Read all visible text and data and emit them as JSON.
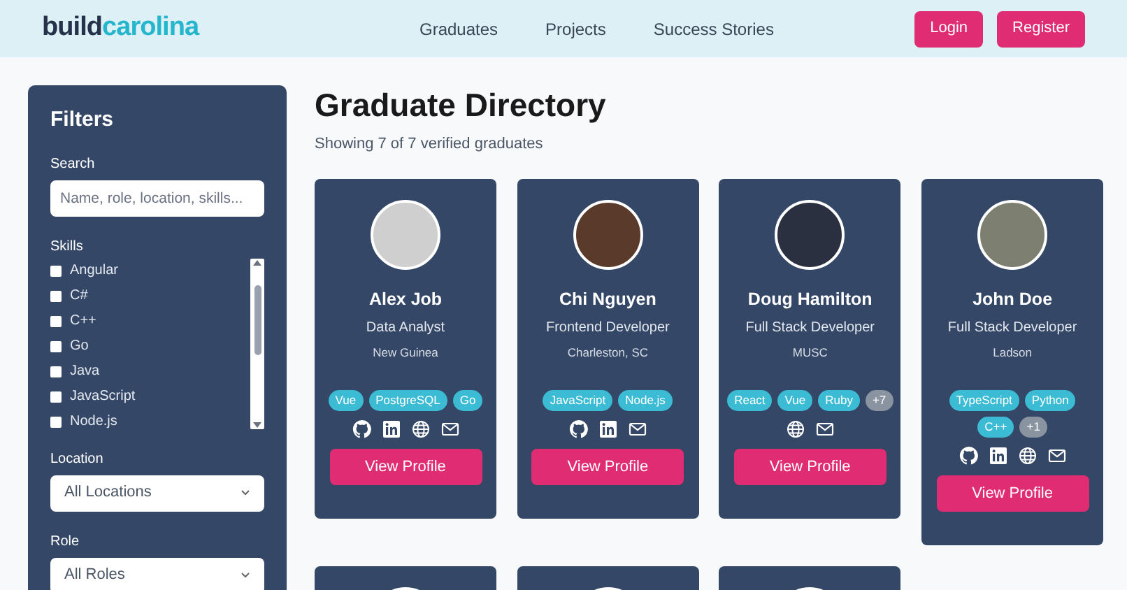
{
  "header": {
    "logo": {
      "part_1": "build",
      "part_2": "carolina"
    },
    "nav": [
      "Graduates",
      "Projects",
      "Success Stories"
    ],
    "buttons": [
      "Login",
      "Register"
    ]
  },
  "filters": {
    "title": "Filters",
    "search": {
      "label": "Search",
      "placeholder": "Name, role, location, skills..."
    },
    "skills": {
      "label": "Skills",
      "options": [
        {
          "label": "Angular",
          "checked": false
        },
        {
          "label": "C#",
          "checked": false
        },
        {
          "label": "C++",
          "checked": false
        },
        {
          "label": "Go",
          "checked": false
        },
        {
          "label": "Java",
          "checked": false
        },
        {
          "label": "JavaScript",
          "checked": false
        },
        {
          "label": "Node.js",
          "checked": false
        }
      ]
    },
    "location": {
      "label": "Location",
      "value": "All Locations"
    },
    "role": {
      "label": "Role",
      "value": "All Roles"
    }
  },
  "directory": {
    "title": "Graduate Directory",
    "summary": "Showing 7 of 7 verified graduates"
  },
  "graduates": [
    {
      "name": "Alex Job",
      "role": "Data Analyst",
      "location": "New Guinea",
      "skills": [
        {
          "label": "Vue",
          "kind": "skill"
        },
        {
          "label": "PostgreSQL",
          "kind": "skill"
        },
        {
          "label": "Go",
          "kind": "skill"
        }
      ],
      "links": [
        {
          "kind": "github"
        },
        {
          "kind": "linkedin"
        },
        {
          "kind": "web"
        },
        {
          "kind": "email"
        }
      ],
      "button": "View Profile"
    },
    {
      "name": "Chi Nguyen",
      "role": "Frontend Developer",
      "location": "Charleston, SC",
      "skills": [
        {
          "label": "JavaScript",
          "kind": "skill"
        },
        {
          "label": "Node.js",
          "kind": "skill"
        }
      ],
      "links": [
        {
          "kind": "github"
        },
        {
          "kind": "linkedin"
        },
        {
          "kind": "email"
        }
      ],
      "button": "View Profile"
    },
    {
      "name": "Doug Hamilton",
      "role": "Full Stack Developer",
      "location": "MUSC",
      "skills": [
        {
          "label": "React",
          "kind": "skill"
        },
        {
          "label": "Vue",
          "kind": "skill"
        },
        {
          "label": "Ruby",
          "kind": "skill"
        },
        {
          "label": "+7",
          "kind": "more"
        }
      ],
      "links": [
        {
          "kind": "web"
        },
        {
          "kind": "email"
        }
      ],
      "button": "View Profile"
    },
    {
      "name": "John Doe",
      "role": "Full Stack Developer",
      "location": "Ladson",
      "skills": [
        {
          "label": "TypeScript",
          "kind": "skill"
        },
        {
          "label": "Python",
          "kind": "skill"
        },
        {
          "label": "C++",
          "kind": "skill"
        },
        {
          "label": "+1",
          "kind": "more"
        }
      ],
      "links": [
        {
          "kind": "github"
        },
        {
          "kind": "linkedin"
        },
        {
          "kind": "web"
        },
        {
          "kind": "email"
        }
      ],
      "button": "View Profile"
    },
    {
      "kind": "partial"
    },
    {
      "kind": "partial"
    },
    {
      "kind": "partial"
    }
  ]
}
